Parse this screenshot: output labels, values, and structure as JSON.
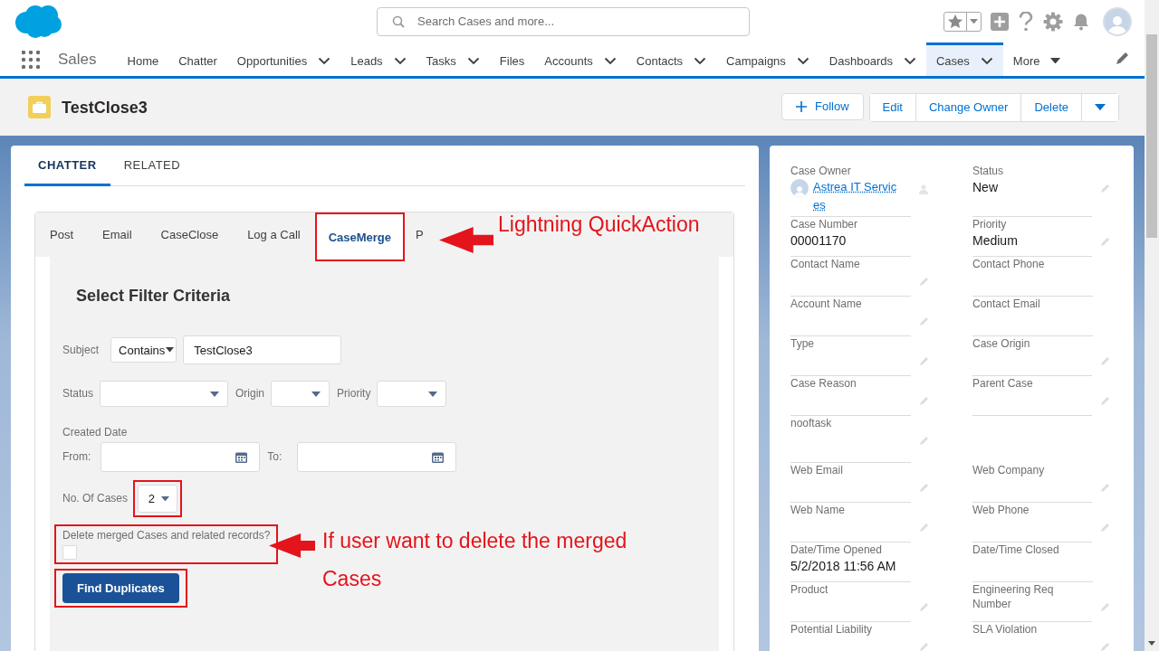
{
  "app": {
    "name": "Sales"
  },
  "search": {
    "placeholder": "Search Cases and more..."
  },
  "nav_items": [
    {
      "label": "Home",
      "kind": "link",
      "selected": false
    },
    {
      "label": "Chatter",
      "kind": "link",
      "selected": false
    },
    {
      "label": "Opportunities",
      "kind": "dropdown",
      "selected": false
    },
    {
      "label": "Leads",
      "kind": "dropdown",
      "selected": false
    },
    {
      "label": "Tasks",
      "kind": "dropdown",
      "selected": false
    },
    {
      "label": "Files",
      "kind": "link",
      "selected": false
    },
    {
      "label": "Accounts",
      "kind": "dropdown",
      "selected": false
    },
    {
      "label": "Contacts",
      "kind": "dropdown",
      "selected": false
    },
    {
      "label": "Campaigns",
      "kind": "dropdown",
      "selected": false
    },
    {
      "label": "Dashboards",
      "kind": "dropdown",
      "selected": false
    },
    {
      "label": "Cases",
      "kind": "dropdown",
      "selected": true
    },
    {
      "label": "More",
      "kind": "more",
      "selected": false
    }
  ],
  "record": {
    "title": "TestClose3",
    "actions": [
      {
        "label": "Follow",
        "kind": "follow"
      },
      {
        "label": "Edit",
        "kind": "button"
      },
      {
        "label": "Change Owner",
        "kind": "button"
      },
      {
        "label": "Delete",
        "kind": "button"
      }
    ]
  },
  "record_tabs": [
    {
      "label": "CHATTER",
      "selected": true
    },
    {
      "label": "RELATED",
      "selected": false
    }
  ],
  "publisher_tabs": [
    {
      "label": "Post",
      "selected": false,
      "highlighted": false
    },
    {
      "label": "Email",
      "selected": false,
      "highlighted": false
    },
    {
      "label": "CaseClose",
      "selected": false,
      "highlighted": false
    },
    {
      "label": "Log a Call",
      "selected": false,
      "highlighted": false
    },
    {
      "label": "CaseMerge",
      "selected": true,
      "highlighted": true
    },
    {
      "label": "P",
      "selected": false,
      "highlighted": false
    }
  ],
  "form": {
    "title": "Select Filter Criteria",
    "subject": {
      "label": "Subject",
      "operator": "Contains",
      "value": "TestClose3"
    },
    "selects": [
      {
        "label": "Status"
      },
      {
        "label": "Origin"
      },
      {
        "label": "Priority"
      }
    ],
    "created_date": {
      "label": "Created Date",
      "from_label": "From:",
      "to_label": "To:"
    },
    "case_count": {
      "label": "No. Of Cases",
      "value": "2",
      "highlighted": true
    },
    "delete_merged": {
      "label": "Delete merged Cases and related records?",
      "checked": false,
      "highlighted": true
    },
    "submit": {
      "label": "Find Duplicates",
      "highlighted": true
    }
  },
  "annotations": [
    {
      "text": "Lightning QuickAction"
    },
    {
      "text": "If user want to delete the merged Cases"
    }
  ],
  "details": {
    "fields": [
      {
        "kind": "owner",
        "label": "Case Owner",
        "value": "Astrea IT Services",
        "editable": false
      },
      {
        "kind": "field",
        "label": "Status",
        "value": "New",
        "editable": true
      },
      {
        "kind": "field",
        "label": "Case Number",
        "value": "00001170",
        "editable": false
      },
      {
        "kind": "field",
        "label": "Priority",
        "value": "Medium",
        "editable": true
      },
      {
        "kind": "field",
        "label": "Contact Name",
        "editable": true
      },
      {
        "kind": "field",
        "label": "Contact Phone",
        "editable": false
      },
      {
        "kind": "field",
        "label": "Account Name",
        "editable": true
      },
      {
        "kind": "field",
        "label": "Contact Email",
        "editable": false
      },
      {
        "kind": "field",
        "label": "Type",
        "editable": true
      },
      {
        "kind": "field",
        "label": "Case Origin",
        "editable": true
      },
      {
        "kind": "field",
        "label": "Case Reason",
        "editable": true
      },
      {
        "kind": "field",
        "label": "Parent Case",
        "editable": true
      },
      {
        "kind": "field",
        "label": "nooftask",
        "editable": true
      },
      {
        "kind": "empty"
      },
      {
        "kind": "field",
        "label": "Web Email",
        "editable": true
      },
      {
        "kind": "field",
        "label": "Web Company",
        "editable": true
      },
      {
        "kind": "field",
        "label": "Web Name",
        "editable": true
      },
      {
        "kind": "field",
        "label": "Web Phone",
        "editable": true
      },
      {
        "kind": "field",
        "label": "Date/Time Opened",
        "value": "5/2/2018 11:56 AM",
        "editable": false
      },
      {
        "kind": "field",
        "label": "Date/Time Closed",
        "editable": false
      },
      {
        "kind": "field",
        "label": "Product",
        "editable": true
      },
      {
        "kind": "field",
        "label": "Engineering Req Number",
        "editable": true
      },
      {
        "kind": "field",
        "label": "Potential Liability",
        "editable": true
      },
      {
        "kind": "field",
        "label": "SLA Violation",
        "editable": true
      }
    ]
  }
}
